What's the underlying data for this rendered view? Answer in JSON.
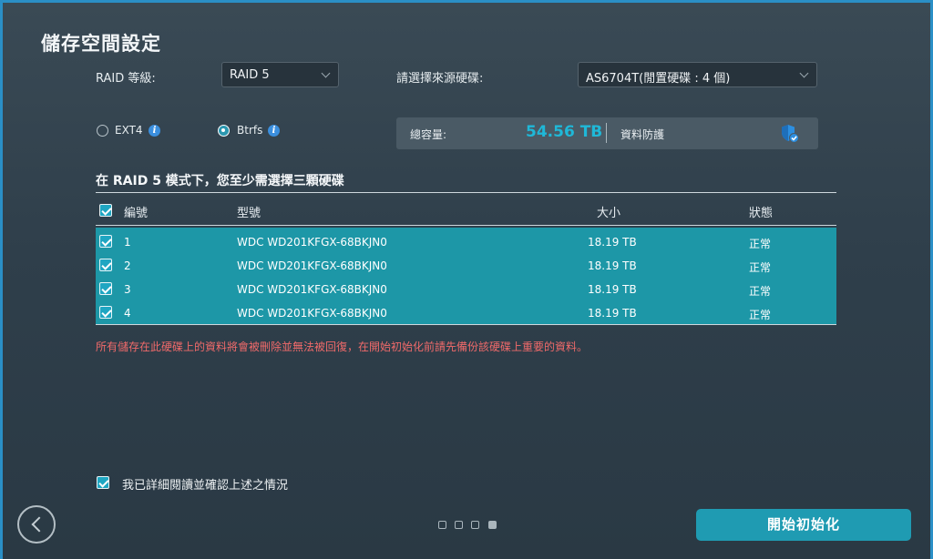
{
  "title": "儲存空間設定",
  "raid": {
    "label": "RAID 等級:",
    "value": "RAID 5"
  },
  "source": {
    "label": "請選擇來源硬碟:",
    "value": "AS6704T(閒置硬碟 : 4 個)"
  },
  "filesystem": {
    "options": [
      {
        "label": "EXT4",
        "selected": false
      },
      {
        "label": "Btrfs",
        "selected": true
      }
    ]
  },
  "capacity": {
    "label": "總容量:",
    "value": "54.56 TB",
    "protect_label": "資料防護"
  },
  "heading": "在 RAID 5 模式下，您至少需選擇三顆硬碟",
  "table": {
    "headers": {
      "number": "編號",
      "model": "型號",
      "size": "大小",
      "status": "狀態"
    },
    "rows": [
      {
        "number": "1",
        "model": "WDC WD201KFGX-68BKJN0",
        "size": "18.19 TB",
        "status": "正常"
      },
      {
        "number": "2",
        "model": "WDC WD201KFGX-68BKJN0",
        "size": "18.19 TB",
        "status": "正常"
      },
      {
        "number": "3",
        "model": "WDC WD201KFGX-68BKJN0",
        "size": "18.19 TB",
        "status": "正常"
      },
      {
        "number": "4",
        "model": "WDC WD201KFGX-68BKJN0",
        "size": "18.19 TB",
        "status": "正常"
      }
    ]
  },
  "warning": "所有儲存在此硬碟上的資料將會被刪除並無法被回復，在開始初始化前請先備份該硬碟上重要的資料。",
  "confirm_label": "我已詳細閱讀並確認上述之情況",
  "pagination": {
    "total": 4,
    "current": 4
  },
  "primary_button": "開始初始化",
  "colors": {
    "accent": "#1f9bb2",
    "value": "#1fb8d8",
    "warning": "#f06a6a",
    "shield": "#2d8fe0"
  }
}
